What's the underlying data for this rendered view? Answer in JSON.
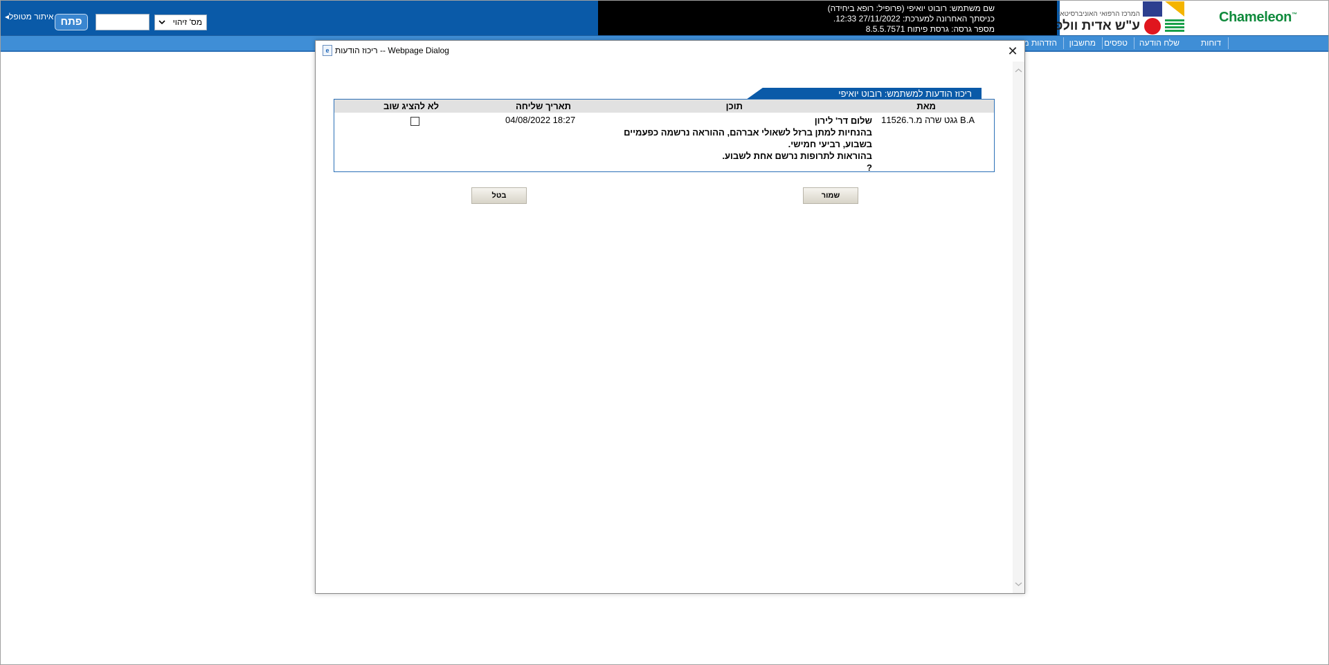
{
  "header": {
    "brand": "Chameleon",
    "brand_tm": "™",
    "hospital_small": "המרכז הרפואי האוניברסיטאי",
    "hospital_name": "ע\"ש אדית וולפסון",
    "user_line1": "שם משתמש: רובוט יואיפי (פרופיל: רופא ביחידה)",
    "user_line2": "כניסתך האחרונה למערכת: 27/11/2022 12:33.",
    "user_line3": "מספר גרסה: גרסת פיתוח 8.5.5.7571",
    "id_type_selected": "מס' זיהוי",
    "id_input_value": "",
    "open_button": "פתח",
    "locate_patient": "איתור מטופל",
    "locate_arrow": "◂"
  },
  "nav": {
    "items": [
      "דוחות",
      "שלח הודעה",
      "טפסים",
      "מחשבון",
      "הזדהות מ"
    ]
  },
  "dialog": {
    "title": "ריכוז הודעות -- Webpage Dialog",
    "close_icon": "✕",
    "section_title": "ריכוז הודעות למשתמש: רובוט יואיפי",
    "columns": {
      "from": "מאת",
      "content": "תוכן",
      "date": "תאריך שליחה",
      "dont_show": "לא להציג שוב"
    },
    "messages": [
      {
        "from": "B.A גגט שרה מ.ר.11526",
        "content_lines": [
          "שלום דר' לירון",
          "בהנחיות למתן ברזל לשאולי אברהם, ההוראה נרשמה כפעמיים",
          "בשבוע, רביעי חמישי.",
          "בהוראות לתרופות נרשם אחת לשבוע.",
          "?"
        ],
        "date": "04/08/2022 18:27",
        "dont_show": false
      }
    ],
    "save_button": "שמור",
    "cancel_button": "בטל"
  }
}
